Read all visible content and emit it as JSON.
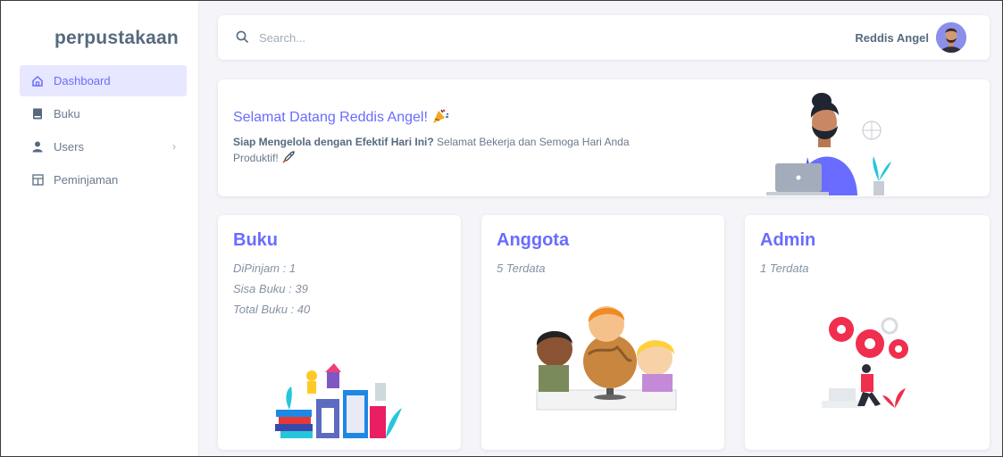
{
  "sidebar": {
    "brand": "perpustakaan",
    "items": [
      {
        "label": "Dashboard",
        "icon": "home-icon",
        "active": true
      },
      {
        "label": "Buku",
        "icon": "book-icon"
      },
      {
        "label": "Users",
        "icon": "user-icon",
        "has_children": true
      },
      {
        "label": "Peminjaman",
        "icon": "table-icon"
      }
    ]
  },
  "navbar": {
    "search_placeholder": "Search...",
    "user_name": "Reddis Angel"
  },
  "welcome": {
    "title": "Selamat Datang Reddis Angel!",
    "text_bold": "Siap Mengelola dengan Efektif Hari Ini?",
    "text_rest": " Selamat Bekerja dan Semoga Hari Anda Produktif!"
  },
  "cards": [
    {
      "title": "Buku",
      "lines": [
        "DiPinjam : 1",
        "Sisa Buku : 39",
        "Total Buku : 40"
      ]
    },
    {
      "title": "Anggota",
      "lines": [
        "5 Terdata"
      ]
    },
    {
      "title": "Admin",
      "lines": [
        "1 Terdata"
      ]
    }
  ],
  "colors": {
    "primary": "#696cff",
    "text": "#697a8d",
    "background": "#f5f5f9"
  }
}
